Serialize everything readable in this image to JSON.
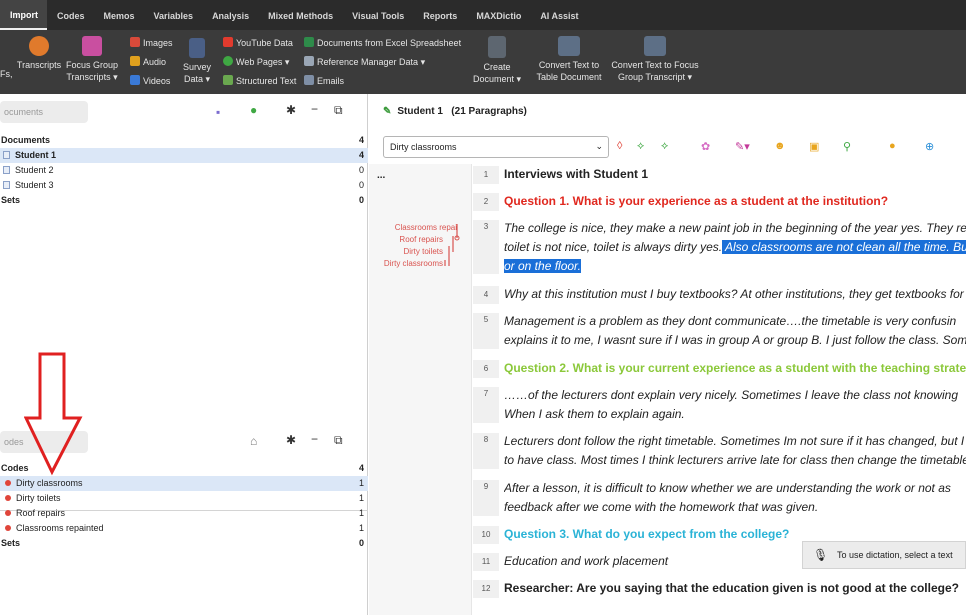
{
  "menu": {
    "tabs": [
      "Import",
      "Codes",
      "Memos",
      "Variables",
      "Analysis",
      "Mixed Methods",
      "Visual Tools",
      "Reports",
      "MAXDictio",
      "AI Assist"
    ],
    "active": "Import"
  },
  "ribbon": {
    "pdfs_label": "Fs,",
    "transcripts": "Transcripts",
    "focus_group_line1": "Focus Group",
    "focus_group_line2": "Transcripts",
    "images": "Images",
    "audio": "Audio",
    "videos": "Videos",
    "survey_line1": "Survey",
    "survey_line2": "Data",
    "youtube": "YouTube Data",
    "web_pages": "Web Pages",
    "structured_text": "Structured Text",
    "documents_excel": "Documents from Excel Spreadsheet",
    "reference_manager": "Reference Manager Data",
    "emails": "Emails",
    "create_line1": "Create",
    "create_line2": "Document",
    "convert_table_line1": "Convert Text to",
    "convert_table_line2": "Table Document",
    "convert_focus_line1": "Convert Text to Focus",
    "convert_focus_line2": "Group Transcript"
  },
  "documents_panel": {
    "search_placeholder": "ocuments",
    "header_label": "Documents",
    "header_count": "4",
    "items": [
      {
        "label": "Student 1",
        "count": "4"
      },
      {
        "label": "Student 2",
        "count": "0"
      },
      {
        "label": "Student 3",
        "count": "0"
      }
    ],
    "sets_label": "Sets",
    "sets_count": "0"
  },
  "codes_panel": {
    "search_placeholder": "odes",
    "header_label": "Codes",
    "header_count": "4",
    "items": [
      {
        "label": "Dirty classrooms",
        "count": "1"
      },
      {
        "label": "Dirty toilets",
        "count": "1"
      },
      {
        "label": "Roof repairs",
        "count": "1"
      },
      {
        "label": "Classrooms repainted",
        "count": "1"
      }
    ],
    "sets_label": "Sets",
    "sets_count": "0"
  },
  "document_browser": {
    "title": "Student 1",
    "paragraphs_label": "(21 Paragraphs)",
    "code_select": "Dirty classrooms",
    "ellipsis": "...",
    "coding_labels": [
      "Classrooms repai",
      "Roof repairs",
      "Dirty toilets",
      "Dirty classrooms"
    ],
    "paragraphs": [
      {
        "num": "1",
        "lines": [
          "Interviews with Student 1"
        ]
      },
      {
        "num": "2",
        "lines": [
          "Question 1. What is your experience as a student at the institution?"
        ]
      },
      {
        "num": "3",
        "lines": [
          "The college is nice, they make a new paint job in the beginning of the year yes. They re",
          "toilet is not nice, toilet is always dirty yes.",
          " Also classrooms are not clean all the time. Bu",
          "or on the floor."
        ]
      },
      {
        "num": "4",
        "lines": [
          "Why at this institution must I buy textbooks? At other institutions, they get textbooks for f"
        ]
      },
      {
        "num": "5",
        "lines": [
          " Management is a problem as they dont communicate….the timetable is very confusin",
          "explains it to me, I wasnt sure if I was in group A or group B. I just follow the class. Somet"
        ]
      },
      {
        "num": "6",
        "lines": [
          "Question 2. What is your current experience as a student with the teaching strateg"
        ]
      },
      {
        "num": "7",
        "lines": [
          "……of the lecturers dont explain very nicely. Sometimes I leave the class not knowing",
          "When I ask them to explain again."
        ]
      },
      {
        "num": "8",
        "lines": [
          "Lecturers dont follow the right timetable. Sometimes Im not sure if it has changed, but I",
          "to have class. Most times I think lecturers arrive late for class then change the timetable"
        ]
      },
      {
        "num": "9",
        "lines": [
          "After a lesson, it is difficult to know whether we are understanding the work or not as",
          "feedback after we come with the homework that was given."
        ]
      },
      {
        "num": "10",
        "lines": [
          "Question 3. What do you expect from the college?"
        ]
      },
      {
        "num": "11",
        "lines": [
          "Education and work placement"
        ]
      },
      {
        "num": "12",
        "lines": [
          "Researcher: Are you saying that the education given is not good at the college?"
        ]
      }
    ]
  },
  "dictation_tooltip": "To use dictation, select a text",
  "colors": {
    "code_red": "#e0281f",
    "question_green": "#8bc83a",
    "question_cyan": "#2ab3d6",
    "highlight": "#1a6fd8",
    "arrow": "#e02020"
  }
}
